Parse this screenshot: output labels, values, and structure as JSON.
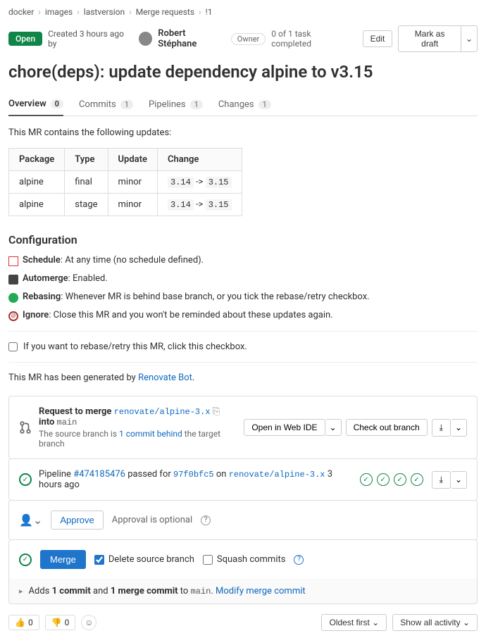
{
  "breadcrumb": [
    "docker",
    "images",
    "lastversion",
    "Merge requests",
    "!1"
  ],
  "status": "Open",
  "created": "Created 3 hours ago by",
  "author": "Robert Stéphane",
  "role": "Owner",
  "tasks": "0 of 1 task completed",
  "edit": "Edit",
  "draft": "Mark as draft",
  "title": "chore(deps): update dependency alpine to v3.15",
  "tabs": [
    {
      "label": "Overview",
      "count": "0"
    },
    {
      "label": "Commits",
      "count": "1"
    },
    {
      "label": "Pipelines",
      "count": "1"
    },
    {
      "label": "Changes",
      "count": "1"
    }
  ],
  "intro": "This MR contains the following updates:",
  "table": {
    "headers": [
      "Package",
      "Type",
      "Update",
      "Change"
    ],
    "rows": [
      {
        "pkg": "alpine",
        "type": "final",
        "update": "minor",
        "from": "3.14",
        "to": "3.15"
      },
      {
        "pkg": "alpine",
        "type": "stage",
        "update": "minor",
        "from": "3.14",
        "to": "3.15"
      }
    ]
  },
  "config_title": "Configuration",
  "configs": [
    {
      "label": "Schedule",
      "text": ": At any time (no schedule defined)."
    },
    {
      "label": "Automerge",
      "text": ": Enabled."
    },
    {
      "label": "Rebasing",
      "text": ": Whenever MR is behind base branch, or you tick the rebase/retry checkbox."
    },
    {
      "label": "Ignore",
      "text": ": Close this MR and you won't be reminded about these updates again."
    }
  ],
  "rebase_checkbox": "If you want to rebase/retry this MR, click this checkbox.",
  "generated_prefix": "This MR has been generated by ",
  "generated_link": "Renovate Bot",
  "merge_req": {
    "title": "Request to merge",
    "src": "renovate/alpine-3.x",
    "into": "into",
    "dst": "main",
    "sub1": "The source branch is ",
    "sub_link": "1 commit behind",
    "sub2": " the target branch",
    "open_ide": "Open in Web IDE",
    "checkout": "Check out branch"
  },
  "pipeline": {
    "label": "Pipeline",
    "id": "#474185476",
    "passed": "passed for",
    "sha": "97f0bfc5",
    "on": "on",
    "branch": "renovate/alpine-3.x",
    "time": "3 hours ago"
  },
  "approve": {
    "btn": "Approve",
    "text": "Approval is optional"
  },
  "merge": {
    "btn": "Merge",
    "del": "Delete source branch",
    "squash": "Squash commits"
  },
  "commits": {
    "prefix": "Adds ",
    "c1": "1 commit",
    "and": " and ",
    "c2": "1 merge commit",
    "to": " to ",
    "branch": "main",
    "modify": "Modify merge commit"
  },
  "reactions": {
    "up": "0",
    "down": "0"
  },
  "sort": "Oldest first",
  "filter": "Show all activity"
}
